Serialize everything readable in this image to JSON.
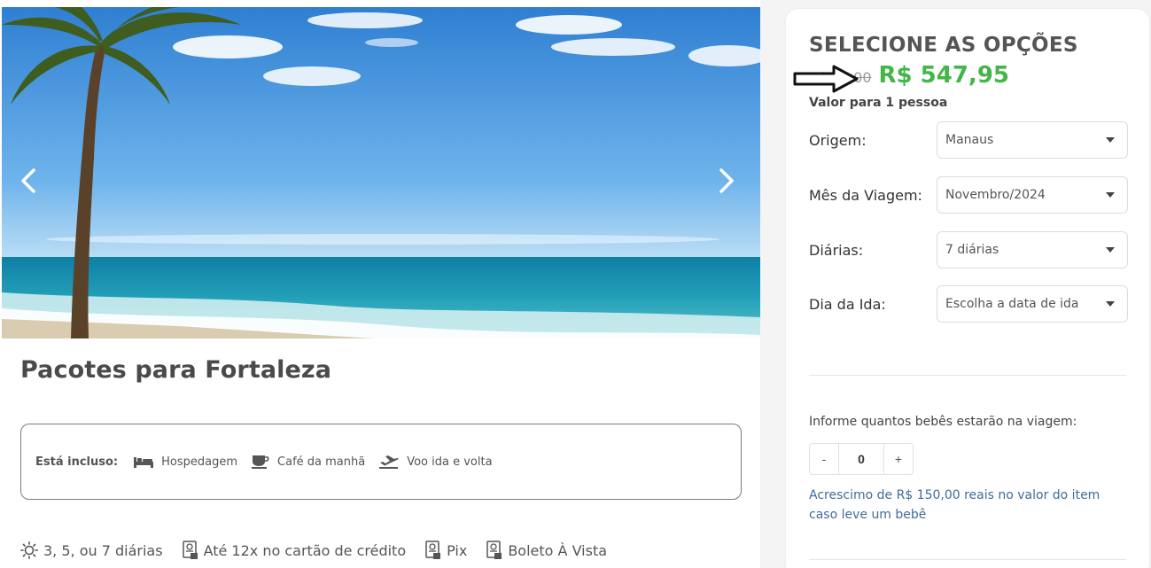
{
  "hero": {
    "prev_icon": "chevron-left-icon",
    "next_icon": "chevron-right-icon"
  },
  "package": {
    "title": "Pacotes para Fortaleza",
    "included_label": "Está incluso:",
    "included": [
      {
        "icon": "bed-icon",
        "label": "Hospedagem"
      },
      {
        "icon": "coffee-icon",
        "label": "Café da manhã"
      },
      {
        "icon": "plane-takeoff-icon",
        "label": "Voo ida e volta"
      }
    ],
    "features": [
      {
        "icon": "sun-icon",
        "label": "3, 5, ou 7 diárias"
      },
      {
        "icon": "card-doc-icon",
        "label": "Até 12x no cartão de crédito"
      },
      {
        "icon": "pix-doc-icon",
        "label": "Pix"
      },
      {
        "icon": "boleto-doc-icon",
        "label": "Boleto À Vista"
      }
    ]
  },
  "panel": {
    "title": "SELECIONE AS OPÇÕES",
    "old_price": "R$ 7?,00",
    "new_price": "R$ 547,95",
    "price_note": "Valor para 1 pessoa",
    "options": [
      {
        "label": "Origem:",
        "value": "Manaus"
      },
      {
        "label": "Mês da Viagem:",
        "value": "Novembro/2024"
      },
      {
        "label": "Diárias:",
        "value": "7 diárias"
      },
      {
        "label": "Dia da Ida:",
        "value": "Escolha a data de ida"
      }
    ],
    "babies": {
      "label": "Informe quantos bebês estarão na viagem:",
      "minus": "-",
      "value": "0",
      "plus": "+",
      "note": "Acrescimo de R$ 150,00 reais no valor do item caso leve um bebê"
    }
  },
  "colors": {
    "price_green": "#43b649",
    "note_blue": "#3f6c9a",
    "sky": "#3b8fd9",
    "sea": "#1f8fa8"
  }
}
